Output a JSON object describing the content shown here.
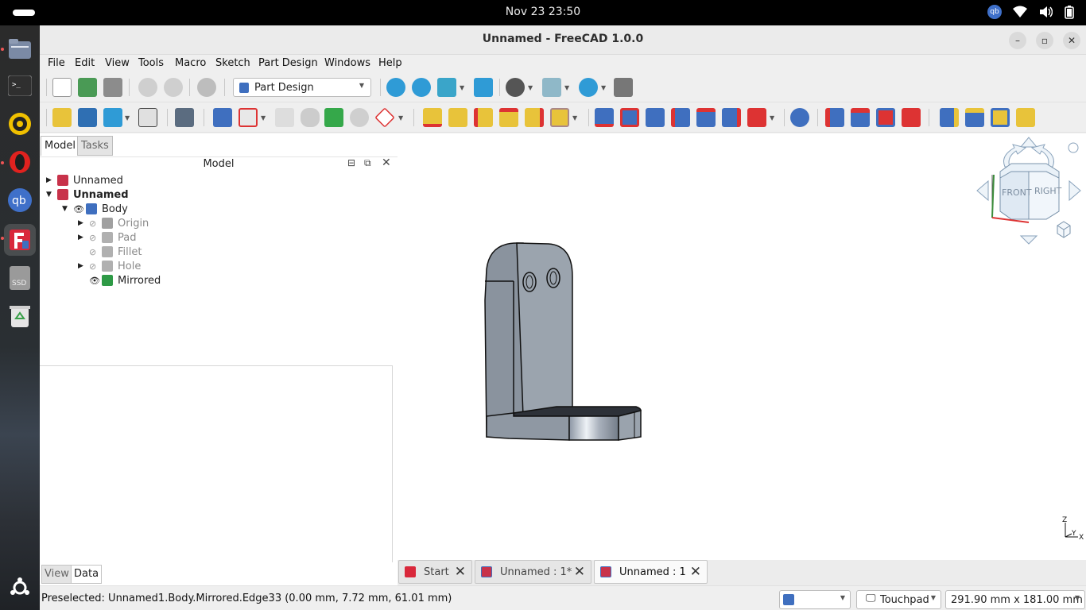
{
  "topbar": {
    "clock": "Nov 23  23:50",
    "tray_qb": "qb"
  },
  "dock": {
    "items": [
      {
        "name": "files",
        "color": "#6d7a94"
      },
      {
        "name": "terminal",
        "color": "#2f2f2f"
      },
      {
        "name": "rhythmbox",
        "color": "#f0c000"
      },
      {
        "name": "opera",
        "color": "#e0221f"
      },
      {
        "name": "qbittorrent",
        "color": "#3f70c9",
        "label": "qb"
      },
      {
        "name": "freecad",
        "color": "#d9283b"
      },
      {
        "name": "ssd",
        "color": "#9a9a9a",
        "label": "SSD"
      },
      {
        "name": "trash",
        "color": "#3aa04a"
      }
    ],
    "show_apps_icon": "show-apps-icon"
  },
  "window": {
    "title": "Unnamed - FreeCAD 1.0.0",
    "controls": {
      "minimize": "–",
      "maximize": "▫",
      "close": "✕"
    }
  },
  "menubar": {
    "items": [
      "File",
      "Edit",
      "View",
      "Tools",
      "Macro",
      "Sketch",
      "Part Design",
      "Windows",
      "Help"
    ]
  },
  "toolbar": {
    "workbench": "Part Design"
  },
  "left_panel": {
    "tabs": [
      "Model",
      "Tasks"
    ],
    "header": "Model",
    "bottom_tabs": [
      "View",
      "Data"
    ],
    "tree": [
      {
        "label": "Unnamed",
        "level": 0,
        "expander": "▶",
        "bold": false,
        "visible": null,
        "icon_color": "#c8324a"
      },
      {
        "label": "Unnamed",
        "level": 0,
        "expander": "▼",
        "bold": true,
        "visible": null,
        "icon_color": "#c8324a"
      },
      {
        "label": "Body",
        "level": 1,
        "expander": "▼",
        "bold": false,
        "visible": true,
        "icon_color": "#3f6fbf"
      },
      {
        "label": "Origin",
        "level": 2,
        "expander": "▶",
        "bold": false,
        "visible": false,
        "icon_color": "#a0a0a0"
      },
      {
        "label": "Pad",
        "level": 2,
        "expander": "▶",
        "bold": false,
        "visible": false,
        "icon_color": "#b0b0b0"
      },
      {
        "label": "Fillet",
        "level": 2,
        "expander": "",
        "bold": false,
        "visible": false,
        "icon_color": "#b0b0b0"
      },
      {
        "label": "Hole",
        "level": 2,
        "expander": "▶",
        "bold": false,
        "visible": false,
        "icon_color": "#b0b0b0"
      },
      {
        "label": "Mirrored",
        "level": 2,
        "expander": "",
        "bold": false,
        "visible": true,
        "icon_color": "#2e9a46"
      }
    ]
  },
  "view3d": {
    "navcube": {
      "front": "FRONT",
      "right": "RIGHT"
    },
    "axis": {
      "z": "Z",
      "y": "Y",
      "x": "X"
    }
  },
  "doc_tabs": [
    {
      "label": "Start",
      "active": false
    },
    {
      "label": "Unnamed : 1*",
      "active": false
    },
    {
      "label": "Unnamed : 1",
      "active": true
    }
  ],
  "statusbar": {
    "text": "Preselected: Unnamed1.Body.Mirrored.Edge33 (0.00 mm, 7.72 mm, 61.01 mm)",
    "nav_style": "Touchpad",
    "dimensions": "291.90 mm x 181.00 mm"
  }
}
